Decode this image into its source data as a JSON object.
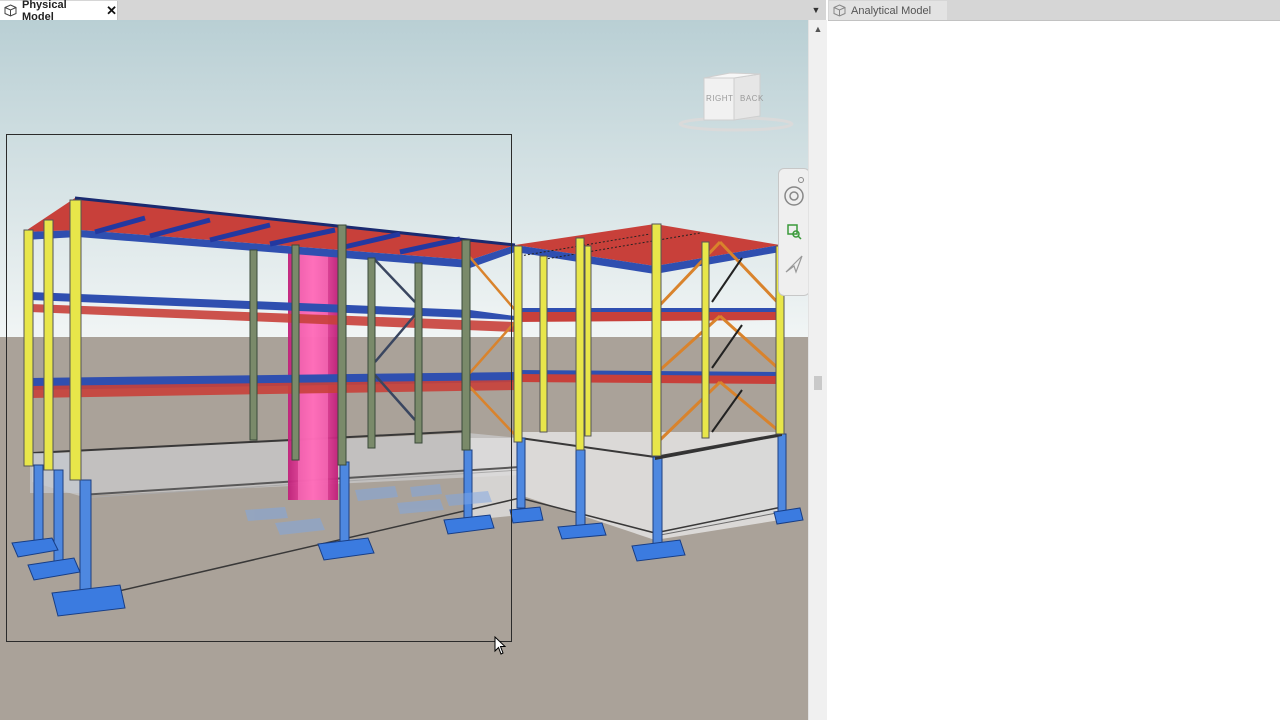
{
  "tabs": {
    "physical": {
      "label": "Physical Model",
      "close": "✕",
      "icon": "model-cube-icon",
      "active": true
    },
    "analytical": {
      "label": "Analytical Model",
      "icon": "model-cube-icon",
      "active": false
    }
  },
  "tab_menu": {
    "icon": "dropdown-arrow-icon",
    "glyph": "▼"
  },
  "scrollbar": {
    "up_glyph": "▲"
  },
  "viewcube": {
    "right": "RIGHT",
    "back": "BACK"
  },
  "navbar": {
    "items": [
      "full-navigation-wheel",
      "zoom-region",
      "orbit"
    ]
  },
  "colors": {
    "sky_top": "#b9cfd4",
    "sky_bottom": "#eef3f3",
    "ground": "#aaa299",
    "column_yellow": "#e8e64a",
    "column_blue": "#4e88e0",
    "beam_red": "#c8403a",
    "deck_blue": "#2f4fb0",
    "brace_orange": "#d9832c",
    "shear_core": "#ff4aa0"
  }
}
